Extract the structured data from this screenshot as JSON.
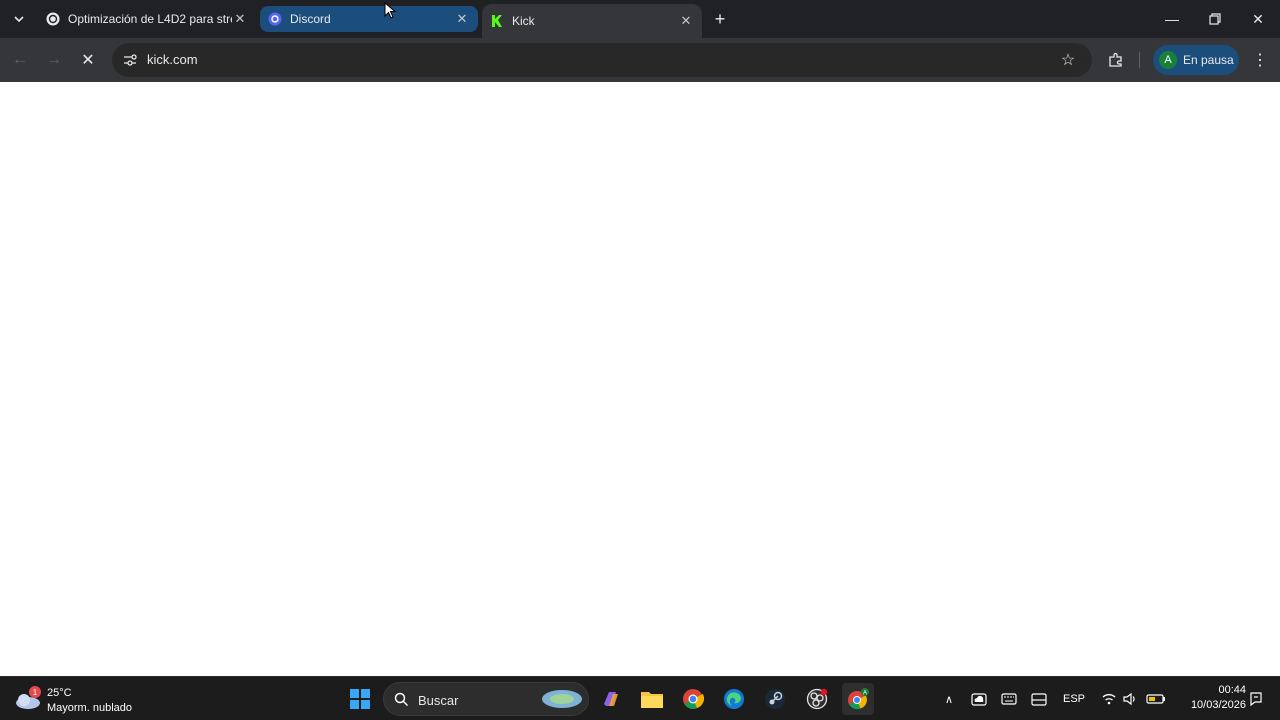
{
  "browser": {
    "tabs": [
      {
        "title": "Optimización de L4D2 para stre",
        "icon": "openai-icon"
      },
      {
        "title": "Discord",
        "icon": "discord-icon"
      },
      {
        "title": "Kick",
        "icon": "kick-icon",
        "active": true
      }
    ],
    "address": "kick.com",
    "profile_initial": "A",
    "profile_label": "En pausa"
  },
  "taskbar": {
    "weather_temp": "25°C",
    "weather_desc": "Mayorm. nublado",
    "weather_badge": "1",
    "search_placeholder": "Buscar",
    "language": "ESP",
    "time": "00:44",
    "date": "10/03/2026",
    "apps": [
      "windows-start-icon",
      "copilot-icon",
      "file-explorer-icon",
      "chrome-icon",
      "edge-icon",
      "steam-icon",
      "obs-icon",
      "chrome-profile-icon"
    ]
  },
  "colors": {
    "tabstrip": "#202124",
    "toolbar": "#35363a",
    "accent_blue": "#1b4e7c",
    "taskbar": "#1c1c1c"
  }
}
